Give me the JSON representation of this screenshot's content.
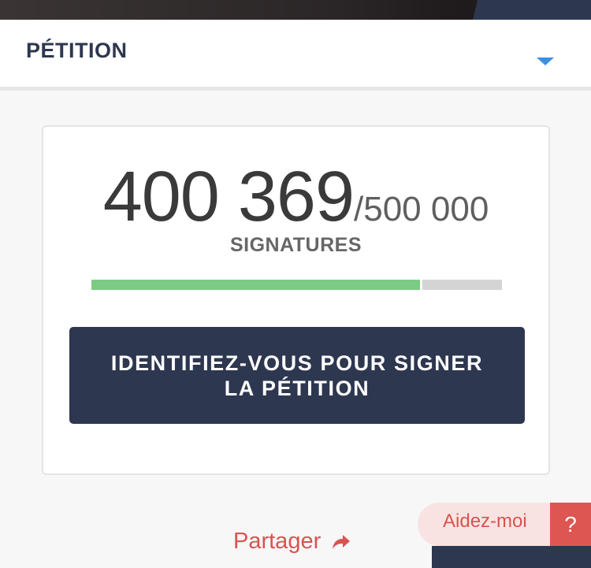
{
  "section": {
    "title": "PÉTITION",
    "dropdown_icon": "caret-down-icon"
  },
  "petition": {
    "signatures_count": "400 369",
    "signatures_goal": "/500 000",
    "signatures_label": "SIGNATURES",
    "progress_fraction": 0.8,
    "progress_color": "#7ccb84",
    "track_color": "#d4d4d4",
    "sign_button_label": "IDENTIFIEZ-VOUS POUR SIGNER LA PÉTITION"
  },
  "share": {
    "label": "Partager",
    "icon": "share-arrow-icon"
  },
  "help": {
    "label": "Aidez-moi",
    "icon_glyph": "?"
  },
  "colors": {
    "navy": "#2e3750",
    "accent_red": "#d9534f",
    "link_blue": "#3d8fe6"
  }
}
